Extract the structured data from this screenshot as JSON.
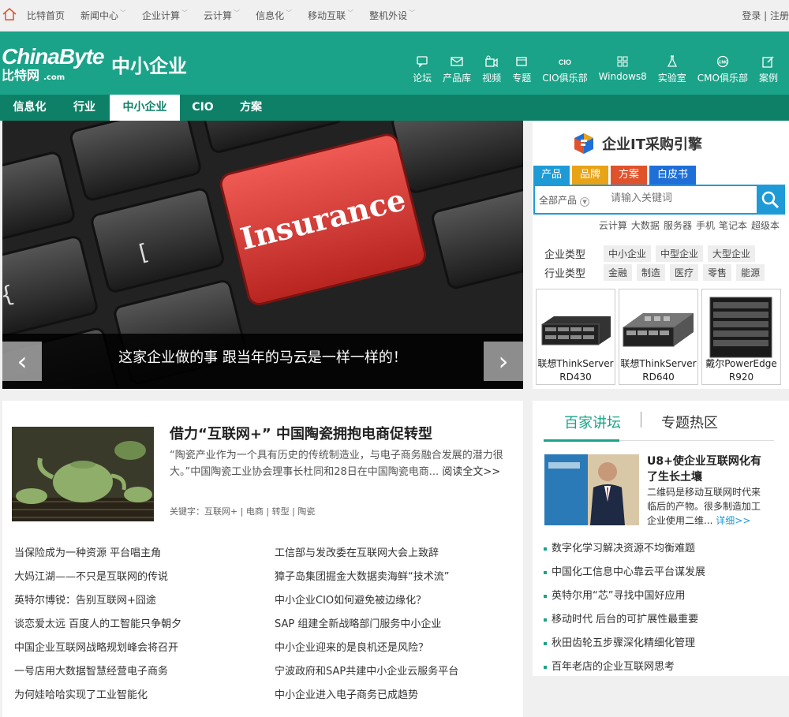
{
  "topbar": {
    "nav": [
      {
        "label": "比特首页",
        "chev": false
      },
      {
        "label": "新闻中心",
        "chev": true
      },
      {
        "label": "企业计算",
        "chev": true
      },
      {
        "label": "云计算",
        "chev": true
      },
      {
        "label": "信息化",
        "chev": true
      },
      {
        "label": "移动互联",
        "chev": true
      },
      {
        "label": "整机外设",
        "chev": true
      }
    ],
    "login": "登录 | 注册"
  },
  "header": {
    "logo_en": "ChinaByte",
    "logo_cn": "比特网",
    "logo_com": ".com",
    "section_title": "中小企业",
    "nav": [
      {
        "label": "论坛",
        "icon": "chat-icon"
      },
      {
        "label": "产品库",
        "icon": "mail-icon"
      },
      {
        "label": "视频",
        "icon": "video-icon"
      },
      {
        "label": "专题",
        "icon": "window-icon"
      },
      {
        "label": "CIO俱乐部",
        "icon": "cio-icon"
      },
      {
        "label": "Windows8",
        "icon": "windows-icon"
      },
      {
        "label": "实验室",
        "icon": "flask-icon"
      },
      {
        "label": "CMO俱乐部",
        "icon": "cmo-icon"
      },
      {
        "label": "案例",
        "icon": "edit-icon"
      }
    ]
  },
  "subnav": [
    {
      "label": "信息化",
      "active": false
    },
    {
      "label": "行业",
      "active": false
    },
    {
      "label": "中小企业",
      "active": true
    },
    {
      "label": "CIO",
      "active": false
    },
    {
      "label": "方案",
      "active": false
    }
  ],
  "banner": {
    "caption": "这家企业做的事 跟当年的马云是一样一样的！",
    "key_text": "Insurance"
  },
  "procurement": {
    "title": "企业IT采购引擎",
    "tabs": [
      {
        "label": "产品",
        "color": "#1e9bd7"
      },
      {
        "label": "品牌",
        "color": "#e8a317"
      },
      {
        "label": "方案",
        "color": "#e0522b"
      },
      {
        "label": "白皮书",
        "color": "#1e6fd7"
      }
    ],
    "category": "全部产品",
    "search_placeholder": "请输入关键词",
    "hot_keywords": [
      "云计算",
      "大数据",
      "服务器",
      "手机",
      "笔记本",
      "超级本"
    ],
    "filters": [
      {
        "label": "企业类型",
        "tags": [
          "中小企业",
          "中型企业",
          "大型企业"
        ]
      },
      {
        "label": "行业类型",
        "tags": [
          "金融",
          "制造",
          "医疗",
          "零售",
          "能源"
        ]
      }
    ],
    "products": [
      {
        "line1": "联想ThinkServer",
        "line2": "RD430"
      },
      {
        "line1": "联想ThinkServer",
        "line2": "RD640"
      },
      {
        "line1": "戴尔PowerEdge",
        "line2": "R920"
      }
    ]
  },
  "featured": {
    "title": "借力“互联网+” 中国陶瓷拥抱电商促转型",
    "desc": "“陶瓷产业作为一个具有历史的传统制造业，与电子商务融合发展的潜力很大。”中国陶瓷工业协会理事长杜同和28日在中国陶瓷电商...",
    "read_more": "阅读全文>>",
    "keywords": "关键字：互联网+ | 电商 | 转型 | 陶瓷"
  },
  "news_left": [
    "当保险成为一种资源 平台唱主角",
    "大妈江湖——不只是互联网的传说",
    "英特尔博锐：告别互联网+囧途",
    "谈恋爱太远 百度人的工智能只争朝夕",
    "中国企业互联网战略规划峰会将召开",
    "一号店用大数据智慧经营电子商务",
    "为何娃哈哈实现了工业智能化"
  ],
  "news_right": [
    "工信部与发改委在互联网大会上致辞",
    "獐子岛集团掘金大数据卖海鲜“技术流”",
    "中小企业CIO如何避免被边缘化？",
    "SAP 组建全新战略部门服务中小企业",
    "中小企业迎来的是良机还是风险？",
    "宁波政府和SAP共建中小企业云服务平台",
    "中小企业进入电子商务已成趋势"
  ],
  "side": {
    "tab_active": "百家讲坛",
    "tab_other": "专题热区",
    "feature_title": "U8+使企业互联网化有了生长土壤",
    "feature_desc": "二维码是移动互联网时代来临后的产物。很多制造加工企业使用二维...",
    "more": "详细>>",
    "items": [
      "数字化学习解决资源不均衡难题",
      "中国化工信息中心靠云平台谋发展",
      "英特尔用“芯”寻找中国好应用",
      "移动时代 后台的可扩展性最重要",
      "秋田齿轮五步骤深化精细化管理",
      "百年老店的企业互联网思考"
    ]
  },
  "colors": {
    "brand": "#1aa388",
    "brand_dark": "#0f8068",
    "accent_blue": "#1e9bd7",
    "key_red": "#e03a36"
  }
}
